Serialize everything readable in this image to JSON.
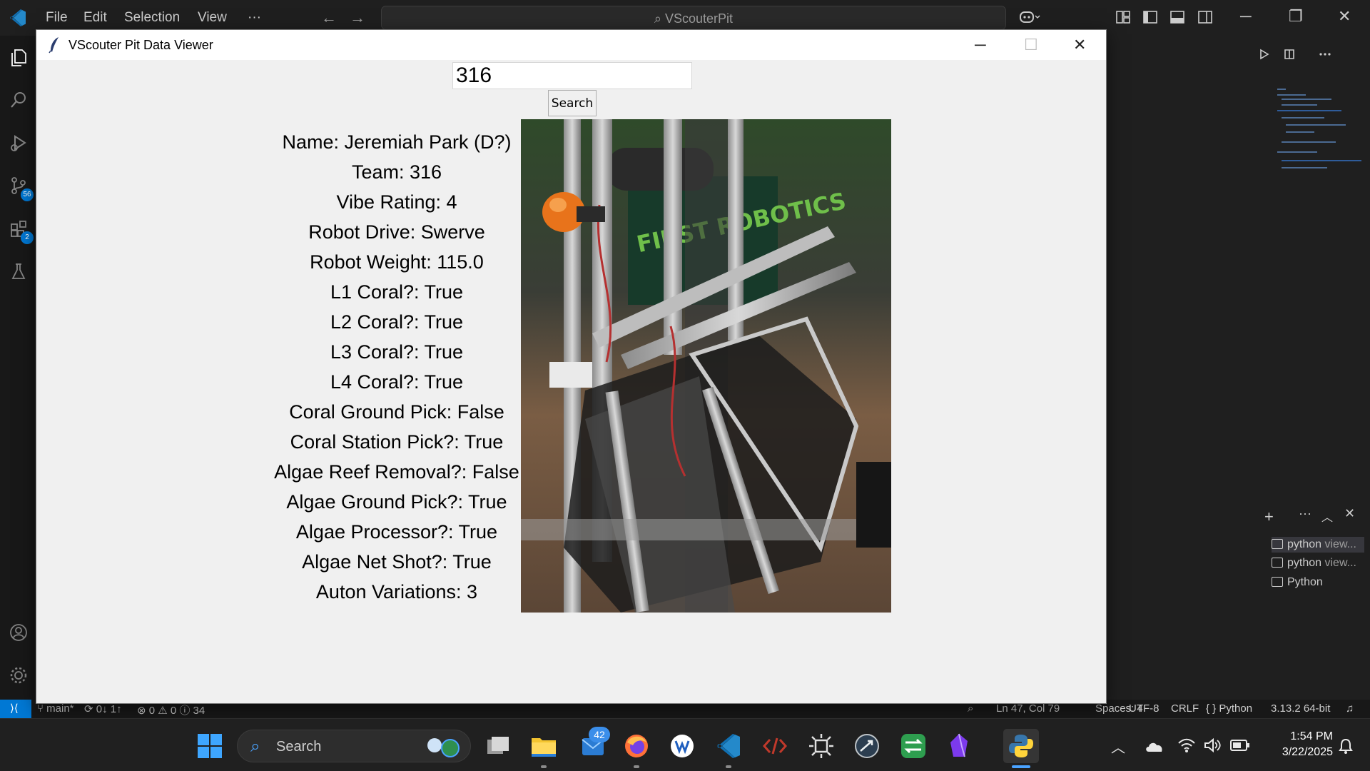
{
  "vscode": {
    "menu": [
      "File",
      "Edit",
      "Selection",
      "View",
      "···"
    ],
    "command_center": "VScouterPit",
    "badges": {
      "source_control": "56",
      "extensions": "2"
    },
    "terminals": [
      {
        "name": "python",
        "detail": "view..."
      },
      {
        "name": "python",
        "detail": "view..."
      },
      {
        "name": "Python",
        "detail": ""
      }
    ],
    "statusbar": {
      "branch": "main*",
      "sync": "0↓ 1↑",
      "problems": "⊗ 0 ⚠ 0 ⓘ 34",
      "position": "Ln 47, Col 79",
      "spaces": "Spaces: 4",
      "encoding": "UTF-8",
      "eol": "CRLF",
      "language": "{ } Python",
      "interpreter": "3.13.2 64-bit"
    }
  },
  "app": {
    "title": "VScouter Pit Data Viewer",
    "search_value": "316",
    "search_button": "Search",
    "info_lines": [
      "Name: Jeremiah Park (D?)",
      "Team: 316",
      "Vibe Rating: 4",
      "Robot Drive: Swerve",
      "Robot Weight: 115.0",
      "L1 Coral?: True",
      "L2 Coral?: True",
      "L3 Coral?: True",
      "L4 Coral?: True",
      "Coral Ground Pick: False",
      "Coral Station Pick?: True",
      "Algae Reef Removal?: False",
      "Algae Ground Pick?: True",
      "Algae Processor?: True",
      "Algae Net Shot?: True",
      "Auton Variations: 3"
    ],
    "photo_sign_text": "FIRST ROBOTICS"
  },
  "taskbar": {
    "search_text": "Search",
    "mail_badge": "42",
    "time": "1:54 PM",
    "date": "3/22/2025"
  },
  "colors": {
    "accent": "#0078d4",
    "editor_bg": "#1f1f1f",
    "app_bg": "#f0f0f0"
  }
}
